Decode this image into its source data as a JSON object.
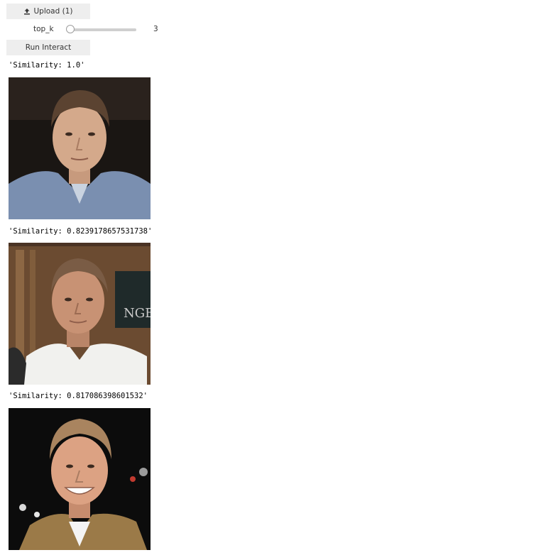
{
  "controls": {
    "upload_label": "Upload (1)",
    "upload_icon": "upload-icon",
    "slider_label": "top_k",
    "slider_value": "3",
    "slider_level": 0,
    "run_label": "Run Interact"
  },
  "results": [
    {
      "similarity_text": "'Similarity: 1.0'"
    },
    {
      "similarity_text": "'Similarity: 0.8239178657531738'"
    },
    {
      "similarity_text": "'Similarity: 0.817086398601532'"
    }
  ]
}
